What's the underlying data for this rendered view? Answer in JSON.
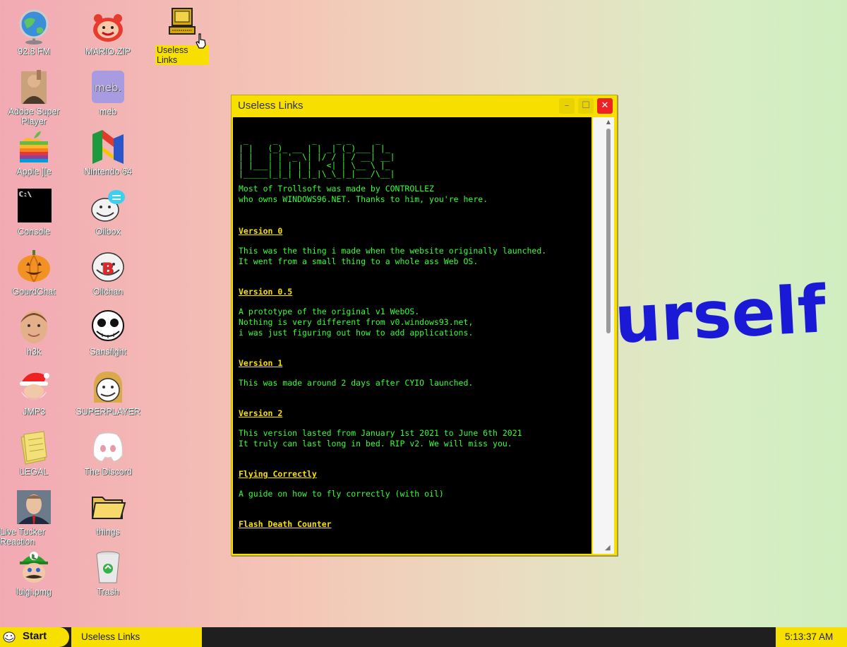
{
  "wallpaper": {
    "text": "urself i"
  },
  "desktop": {
    "icons": [
      {
        "label": "92.8 FM",
        "icon": "globe-icon"
      },
      {
        "label": "MARIO.ZIP",
        "icon": "mario-face-icon"
      },
      {
        "label": "Useless Links",
        "icon": "computer-icon"
      },
      {
        "label": "Adobe Super Player",
        "icon": "man-portrait-icon"
      },
      {
        "label": "meb",
        "icon": "meb-icon"
      },
      {
        "label": "Apple ][e",
        "icon": "apple-logo-icon"
      },
      {
        "label": "Nintendo 64",
        "icon": "n64-logo-icon"
      },
      {
        "label": "Console",
        "icon": "console-icon",
        "glyph_text": "C:\\"
      },
      {
        "label": "Oilbox",
        "icon": "trollface-chat-icon"
      },
      {
        "label": "GourdChat",
        "icon": "pumpkin-icon"
      },
      {
        "label": "Oilchan",
        "icon": "trollface-b-icon"
      },
      {
        "label": "h3k",
        "icon": "face-portrait-icon"
      },
      {
        "label": "Sansfight",
        "icon": "skull-icon"
      },
      {
        "label": "JMP3",
        "icon": "santa-icon"
      },
      {
        "label": "SUPERPLAYER",
        "icon": "meme-face-icon"
      },
      {
        "label": "LEGAL",
        "icon": "legal-papers-icon"
      },
      {
        "label": "The Discord",
        "icon": "discord-icon"
      },
      {
        "label": "Live Tucker Reaction",
        "icon": "tucker-portrait-icon"
      },
      {
        "label": "things",
        "icon": "folder-icon"
      },
      {
        "label": "luigi.pmg",
        "icon": "luigi-icon"
      },
      {
        "label": "Trash",
        "icon": "trash-icon"
      }
    ]
  },
  "window": {
    "title": "Useless Links",
    "min_symbol": "–",
    "max_symbol": "☐",
    "close_symbol": "✕",
    "ascii_art": " _     _       _    _ _     _\n| |   (_)_ __ | | _| (_)___| |_\n| |   | | '_ \\| |/ / | / __| __|\n| |___| | | | |   <| | \\__ \\ |_\n|_____|_|_| |_|_|\\_\\_|_|___/\\__|",
    "intro": "Most of Trollsoft was made by CONTROLLEZ\nwho owns WINDOWS96.NET. Thanks to him, you're here.",
    "sections": [
      {
        "title": "Version 0",
        "body": "This was the thing i made when the website originally launched.\nIt went from a small thing to a whole ass Web OS."
      },
      {
        "title": "Version 0.5",
        "body": "A prototype of the original v1 WebOS.\nNothing is very different from v0.windows93.net,\ni was just figuring out how to add applications."
      },
      {
        "title": "Version 1",
        "body": "This was made around 2 days after CYIO launched."
      },
      {
        "title": "Version 2",
        "body": "This version lasted from January 1st 2021 to June 6th 2021\nIt truly can last long in bed. RIP v2. We will miss you."
      },
      {
        "title": "Flying Correctly",
        "body": "A guide on how to fly correctly (with oil)"
      },
      {
        "title": "Flash Death Counter",
        "body": ""
      }
    ],
    "scroll_up_symbol": "▲",
    "resize_symbol": "◢"
  },
  "taskbar": {
    "start_label": "Start",
    "tasks": [
      "Useless Links"
    ],
    "clock": "5:13:37 AM"
  },
  "colors": {
    "accent": "#f7e000",
    "terminal_text": "#35ff35",
    "link": "#f7e000",
    "close": "#e22222"
  }
}
